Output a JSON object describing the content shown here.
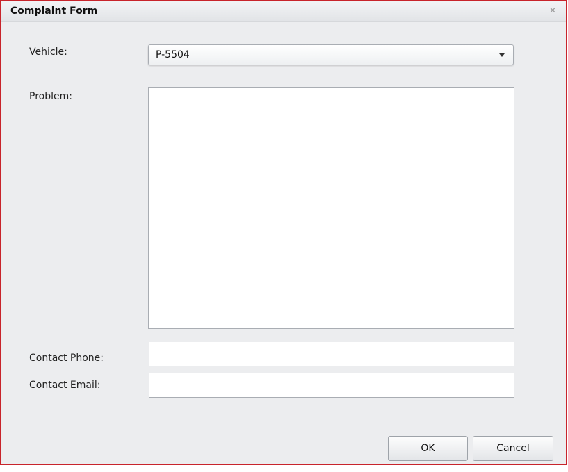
{
  "dialog": {
    "title": "Complaint Form",
    "close_icon": "close-icon"
  },
  "form": {
    "vehicle_label": "Vehicle:",
    "vehicle_value": "P-5504",
    "problem_label": "Problem:",
    "problem_value": "",
    "phone_label": "Contact Phone:",
    "phone_value": "",
    "email_label": "Contact Email:",
    "email_value": ""
  },
  "buttons": {
    "ok_label": "OK",
    "cancel_label": "Cancel"
  },
  "colors": {
    "border_accent": "#c8242b",
    "background": "#ecedef"
  }
}
